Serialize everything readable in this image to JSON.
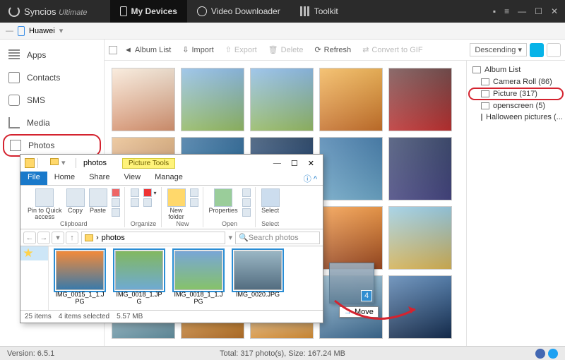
{
  "app": {
    "brand": "Syncios",
    "edition": "Ultimate",
    "tabs": [
      {
        "label": "My Devices",
        "name": "tab-my-devices",
        "active": true
      },
      {
        "label": "Video Downloader",
        "name": "tab-video-downloader",
        "active": false
      },
      {
        "label": "Toolkit",
        "name": "tab-toolkit",
        "active": false
      }
    ]
  },
  "device": {
    "name": "Huawei"
  },
  "sidebar": {
    "items": [
      {
        "label": "Apps",
        "name": "sidebar-item-apps",
        "icon": "apps"
      },
      {
        "label": "Contacts",
        "name": "sidebar-item-contacts",
        "icon": "contacts"
      },
      {
        "label": "SMS",
        "name": "sidebar-item-sms",
        "icon": "sms"
      },
      {
        "label": "Media",
        "name": "sidebar-item-media",
        "icon": "media"
      },
      {
        "label": "Photos",
        "name": "sidebar-item-photos",
        "icon": "photos",
        "selected": true
      }
    ]
  },
  "toolbar": {
    "album_list": "Album List",
    "import": "Import",
    "export": "Export",
    "delete": "Delete",
    "refresh": "Refresh",
    "convert_gif": "Convert to GIF",
    "sort": "Descending"
  },
  "albums": {
    "header": "Album List",
    "items": [
      {
        "label": "Camera Roll (86)",
        "name": "album-camera-roll"
      },
      {
        "label": "Picture (317)",
        "name": "album-picture",
        "selected": true
      },
      {
        "label": "openscreen (5)",
        "name": "album-openscreen"
      },
      {
        "label": "Halloween pictures (...",
        "name": "album-halloween"
      }
    ]
  },
  "status": {
    "version_label": "Version: 6.5.1",
    "summary": "Total: 317 photo(s), Size: 167.24 MB"
  },
  "explorer": {
    "title": "photos",
    "tools_tab": "Picture Tools",
    "ribbon": {
      "file": "File",
      "tabs": [
        "Home",
        "Share",
        "View",
        "Manage"
      ],
      "groups": {
        "clipboard": {
          "label": "Clipboard",
          "pin": "Pin to Quick\naccess",
          "copy": "Copy",
          "paste": "Paste"
        },
        "organize": {
          "label": "Organize"
        },
        "new": {
          "label": "New",
          "newfolder": "New\nfolder"
        },
        "open": {
          "label": "Open",
          "properties": "Properties"
        },
        "select": {
          "label": "Select",
          "select": "Select"
        }
      }
    },
    "address": {
      "path": "photos",
      "search_placeholder": "Search photos"
    },
    "files": [
      {
        "name": "IMG_0015_1_1.JPG",
        "cls": "ft1",
        "selected": true
      },
      {
        "name": "IMG_0018_1.JPG",
        "cls": "ft2",
        "selected": true
      },
      {
        "name": "IMG_0018_1_1.JPG",
        "cls": "ft3",
        "selected": true
      },
      {
        "name": "IMG_0020.JPG",
        "cls": "ft4",
        "selected": true
      }
    ],
    "status": {
      "count": "25 items",
      "selected": "4 items selected",
      "size": "5.57 MB"
    }
  },
  "drag": {
    "count": "4",
    "tip_label": "Move",
    "tip_arrow": "→"
  },
  "thumbs": [
    "t1",
    "t2",
    "t3",
    "t4",
    "t5",
    "t6",
    "t7",
    "t8",
    "t9",
    "t10",
    "t11",
    "t12",
    "t13",
    "t14",
    "t15",
    "t16",
    "t17",
    "t18",
    "t19",
    "t20"
  ]
}
